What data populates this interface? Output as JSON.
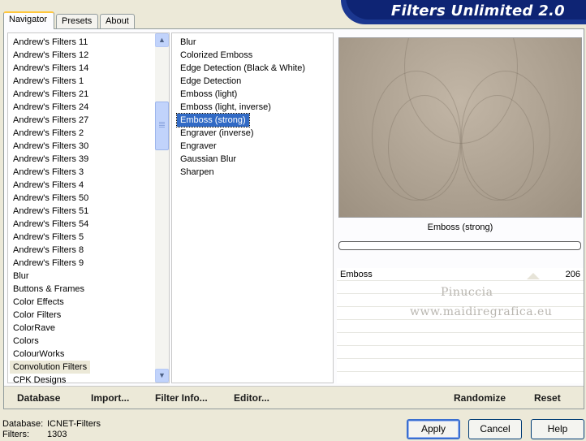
{
  "banner": {
    "title": "Filters Unlimited 2.0"
  },
  "tabs": [
    {
      "label": "Navigator"
    },
    {
      "label": "Presets"
    },
    {
      "label": "About"
    }
  ],
  "categories": [
    "Andrew's Filters 11",
    "Andrew's Filters 12",
    "Andrew's Filters 14",
    "Andrew's Filters 1",
    "Andrew's Filters 21",
    "Andrew's Filters 24",
    "Andrew's Filters 27",
    "Andrew's Filters 2",
    "Andrew's Filters 30",
    "Andrew's Filters 39",
    "Andrew's Filters 3",
    "Andrew's Filters 4",
    "Andrew's Filters 50",
    "Andrew's Filters 51",
    "Andrew's Filters 54",
    "Andrew's Filters 5",
    "Andrew's Filters 8",
    "Andrew's Filters 9",
    "Blur",
    "Buttons & Frames",
    "Color Effects",
    "Color Filters",
    "ColorRave",
    "Colors",
    "ColourWorks",
    "Convolution Filters",
    "CPK Designs"
  ],
  "selected_category": "Convolution Filters",
  "filters": [
    "Blur",
    "Colorized Emboss",
    "Edge Detection (Black & White)",
    "Edge Detection",
    "Emboss (light)",
    "Emboss (light, inverse)",
    "Emboss (strong)",
    "Engraver (inverse)",
    "Engraver",
    "Gaussian Blur",
    "Sharpen"
  ],
  "selected_filter": "Emboss (strong)",
  "preview": {
    "caption": "Emboss (strong)"
  },
  "params": {
    "name": "Emboss",
    "value": "206"
  },
  "watermark": {
    "line1": "Pinuccia",
    "line2": "www.maidiregrafica.eu"
  },
  "bottom_links": {
    "database": "Database",
    "import": "Import...",
    "filter_info": "Filter Info...",
    "editor": "Editor...",
    "randomize": "Randomize",
    "reset": "Reset"
  },
  "status": {
    "database_label": "Database:",
    "database_value": "ICNET-Filters",
    "filters_label": "Filters:",
    "filters_value": "1303"
  },
  "buttons": {
    "apply": "Apply",
    "cancel": "Cancel",
    "help": "Help"
  }
}
